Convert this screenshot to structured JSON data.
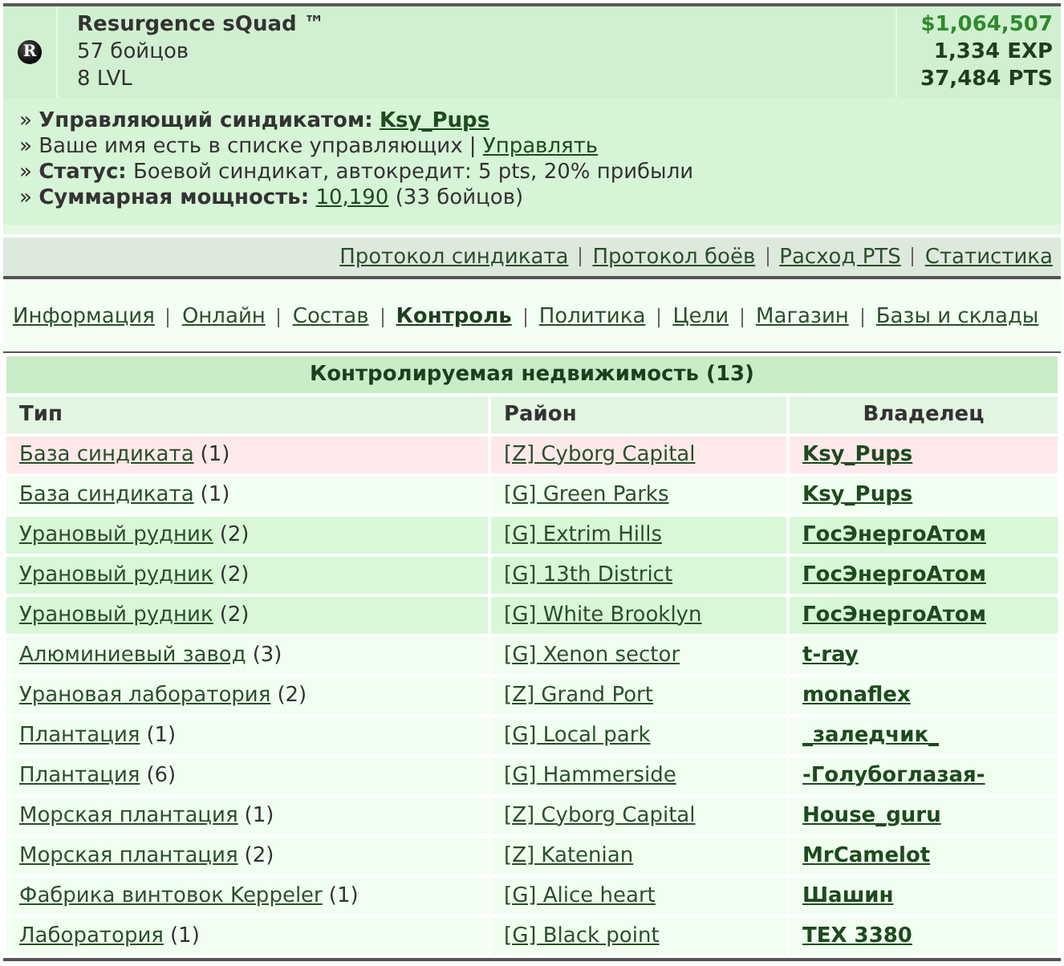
{
  "syndicate": {
    "emblem": "R",
    "name": "Resurgence sQuad ™",
    "members": "57 бойцов",
    "level": "8 LVL",
    "money": "$1,064,507",
    "exp": "1,334 EXP",
    "pts": "37,484 PTS"
  },
  "info": [
    {
      "text": "» **Управляющий синдикатом:** ",
      "link": {
        "text": "Ksy_Pups",
        "bold": true
      }
    },
    {
      "text": "» Ваше имя есть в списке управляющих | ",
      "link": {
        "text": "Управлять",
        "bold": false
      }
    },
    {
      "text": "» **Статус:** Боевой синдикат, автокредит: 5 pts, 20% прибыли"
    },
    {
      "text": "» **Суммарная мощность:** ",
      "link": {
        "text": "10,190",
        "bold": false
      },
      "after": " (33 бойцов)"
    }
  ],
  "log_links": [
    "Протокол синдиката",
    "Протокол боёв",
    "Расход PTS",
    "Статистика"
  ],
  "tabs": [
    {
      "label": "Информация",
      "selected": false
    },
    {
      "label": "Онлайн",
      "selected": false
    },
    {
      "label": "Состав",
      "selected": false
    },
    {
      "label": "Контроль",
      "selected": true
    },
    {
      "label": "Политика",
      "selected": false
    },
    {
      "label": "Цели",
      "selected": false
    },
    {
      "label": "Магазин",
      "selected": false
    },
    {
      "label": "Базы и склады",
      "selected": false
    }
  ],
  "table": {
    "title": "Контролируемая недвижимость (13)",
    "columns": [
      "Тип",
      "Район",
      "Владелец"
    ],
    "rows": [
      {
        "type": "База синдиката",
        "count": "(1)",
        "district": "[Z] Cyborg Capital",
        "owner": "Ksy_Pups",
        "color": "#fde9e9"
      },
      {
        "type": "База синдиката",
        "count": "(1)",
        "district": "[G] Green Parks",
        "owner": "Ksy_Pups",
        "color": "#f0fff0"
      },
      {
        "type": "Урановый рудник",
        "count": "(2)",
        "district": "[G] Extrim Hills",
        "owner": "ГосЭнергоАтом",
        "color": "#d8f8d8"
      },
      {
        "type": "Урановый рудник",
        "count": "(2)",
        "district": "[G] 13th District",
        "owner": "ГосЭнергоАтом",
        "color": "#d8f8d8"
      },
      {
        "type": "Урановый рудник",
        "count": "(2)",
        "district": "[G] White Brooklyn",
        "owner": "ГосЭнергоАтом",
        "color": "#d8f8d8"
      },
      {
        "type": "Алюминиевый завод",
        "count": "(3)",
        "district": "[G] Xenon sector",
        "owner": "t-ray",
        "color": "#f0fff0"
      },
      {
        "type": "Урановая лаборатория",
        "count": "(2)",
        "district": "[Z] Grand Port",
        "owner": "monaflex",
        "color": "#f0fff0"
      },
      {
        "type": "Плантация",
        "count": "(1)",
        "district": "[G] Local park",
        "owner": "_заледчик_",
        "color": "#f0fff0"
      },
      {
        "type": "Плантация",
        "count": "(6)",
        "district": "[G] Hammerside",
        "owner": "-Голубоглазая-",
        "color": "#f0fff0"
      },
      {
        "type": "Морская плантация",
        "count": "(1)",
        "district": "[Z] Cyborg Capital",
        "owner": "House_guru",
        "color": "#f0fff0"
      },
      {
        "type": "Морская плантация",
        "count": "(2)",
        "district": "[Z] Katenian",
        "owner": "MrCamelot",
        "color": "#f0fff0"
      },
      {
        "type": "Фабрика винтовок Keppeler",
        "count": "(1)",
        "district": "[G] Alice heart",
        "owner": "Шашин",
        "color": "#f0fff0"
      },
      {
        "type": "Лаборатория",
        "count": "(1)",
        "district": "[G] Black point",
        "owner": "TEX 3380",
        "color": "#f0fff0"
      }
    ]
  }
}
